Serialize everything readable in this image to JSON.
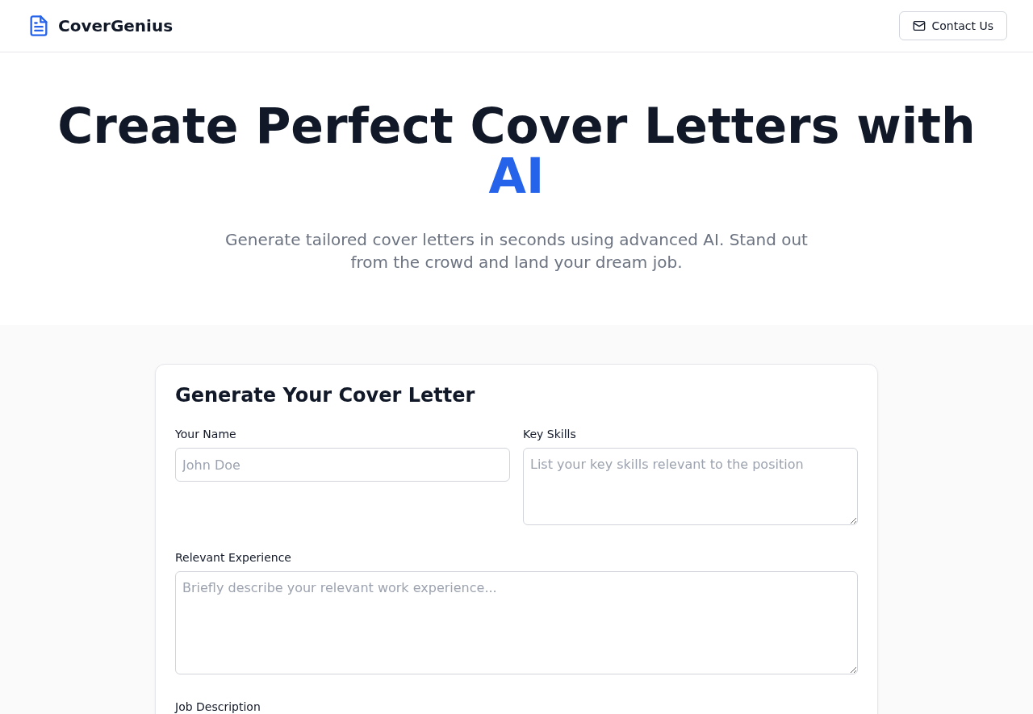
{
  "header": {
    "brand": "CoverGenius",
    "contact_button": "Contact Us"
  },
  "hero": {
    "title": "Create Perfect Cover Letters with",
    "title_highlight": "AI",
    "subtitle": "Generate tailored cover letters in seconds using advanced AI. Stand out from the crowd and land your dream job."
  },
  "form": {
    "title": "Generate Your Cover Letter",
    "fields": [
      {
        "kind": "input",
        "label": "Your Name",
        "placeholder": "John Doe"
      },
      {
        "kind": "textarea",
        "label": "Key Skills",
        "placeholder": "List your key skills relevant to the position"
      },
      {
        "kind": "textarea",
        "label": "Relevant Experience",
        "placeholder": "Briefly describe your relevant work experience..."
      },
      {
        "kind": "textarea",
        "label": "Job Description"
      }
    ]
  }
}
